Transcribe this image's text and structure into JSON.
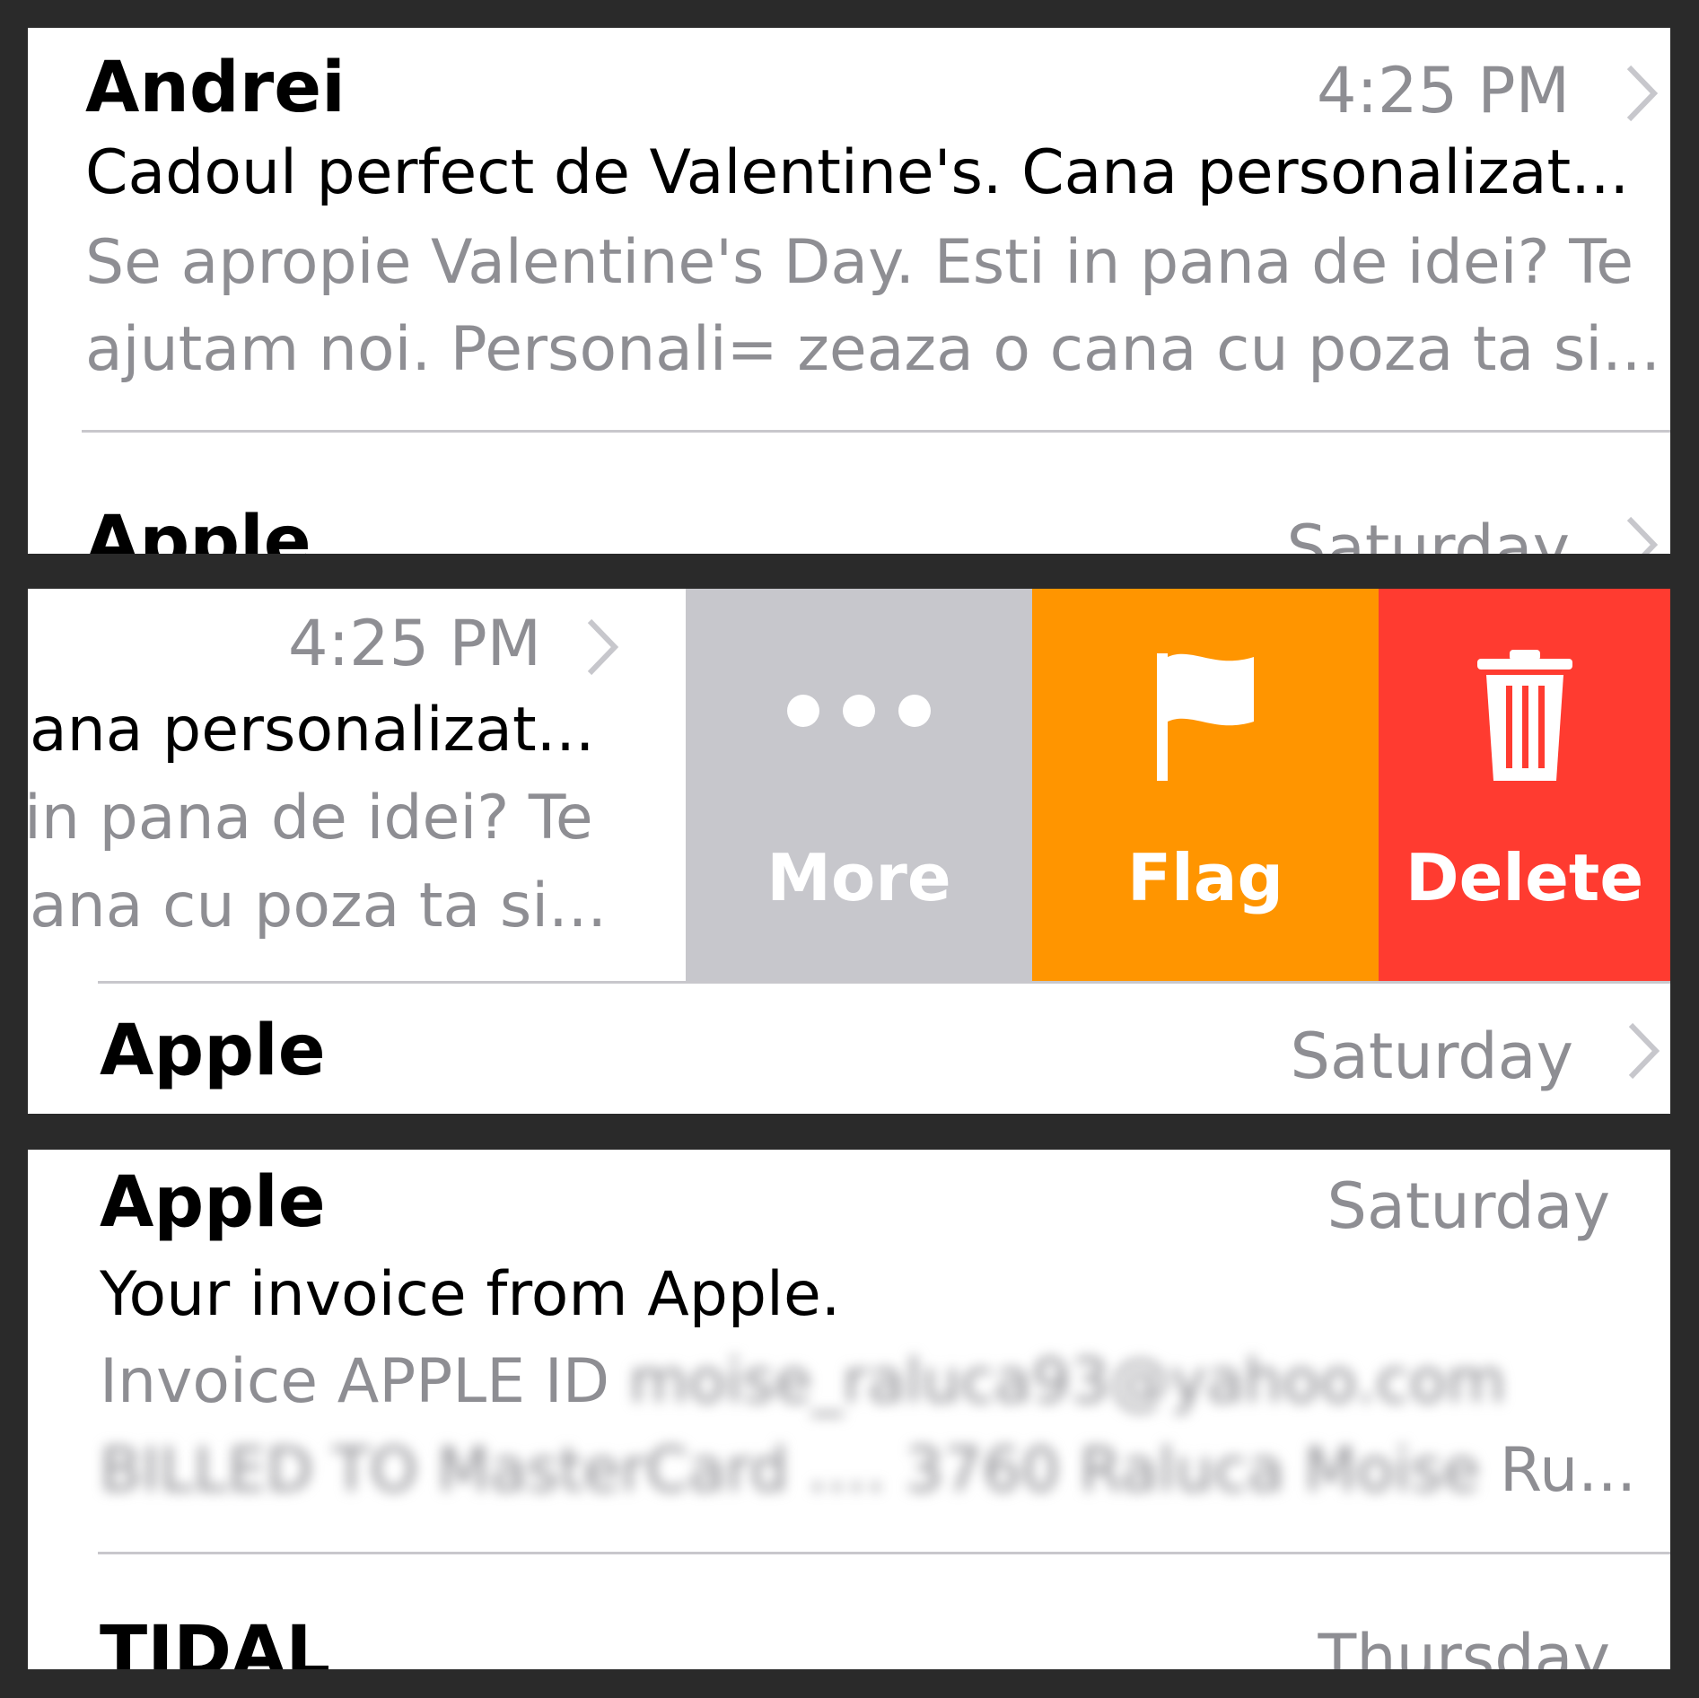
{
  "panel_1": {
    "row_1": {
      "sender": "Andrei",
      "time": "4:25 PM",
      "subject": "Cadoul perfect de Valentine's. Cana personalizat...",
      "preview_line_1": "Se apropie Valentine's Day. Esti in pana de idei? Te",
      "preview_line_2": "ajutam noi. Personali= zeaza o cana cu poza ta si..."
    },
    "row_2": {
      "sender": "Apple",
      "time": "Saturday"
    }
  },
  "panel_2": {
    "row_1": {
      "time": "4:25 PM",
      "subject_fragment": "ana personalizat...",
      "preview_fragment_1": "in pana de idei? Te",
      "preview_fragment_2": "ana cu poza ta si..."
    },
    "actions": {
      "more": {
        "label": "More",
        "icon": "ellipsis-icon",
        "color": "#c7c7cc"
      },
      "flag": {
        "label": "Flag",
        "icon": "flag-icon",
        "color": "#ff9500"
      },
      "delete": {
        "label": "Delete",
        "icon": "trash-icon",
        "color": "#ff3b30"
      }
    },
    "row_2": {
      "sender": "Apple",
      "time": "Saturday"
    }
  },
  "panel_3": {
    "row_1": {
      "sender": "Apple",
      "time": "Saturday",
      "subject": "Your invoice from Apple.",
      "preview_prefix": "Invoice APPLE ID",
      "preview_blurred_1": "moise_raluca93@yahoo.com",
      "preview_blurred_2": "BILLED TO MasterCard .... 3760 Raluca Moise",
      "preview_suffix": "Ru..."
    },
    "row_2": {
      "sender": "TIDAL",
      "time": "Thursday"
    }
  }
}
